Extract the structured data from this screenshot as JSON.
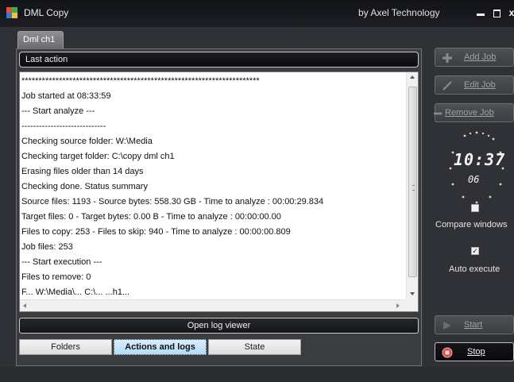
{
  "window": {
    "title": "DML Copy",
    "vendor": "by Axel Technology",
    "minimize_label": "",
    "maximize_label": "",
    "close_label": "x"
  },
  "tabs": [
    {
      "label": "Dml ch1"
    }
  ],
  "section": {
    "header": "Last action"
  },
  "log": {
    "lines": [
      "**********************************************************************",
      "Job started at 08:33:59",
      "--- Start analyze ---",
      "-----------------------------",
      "Checking source folder: W:\\Media",
      "Checking target folder: C:\\copy dml ch1",
      "Erasing files older than 14 days",
      "Checking done. Status summary",
      "Source files: 1193 - Source bytes: 558.30 GB - Time to analyze : 00:00:29.834",
      "Target files: 0 - Target bytes: 0.00 B - Time to analyze : 00:00:00.00",
      "Files to copy: 253 - Files to skip: 940 - Time to analyze : 00:00:00.809",
      "Job files: 253",
      "--- Start execution ---",
      "Files to remove: 0",
      "F...   W:\\Media\\...   C:\\...   ...h1..."
    ]
  },
  "buttons": {
    "open_log_viewer": "Open log viewer",
    "add_job": "Add Job",
    "edit_job": "Edit Job",
    "remove_job": "Remove Job",
    "start": "Start",
    "stop": "Stop"
  },
  "bottom_tabs": [
    {
      "label": "Folders"
    },
    {
      "label": "Actions and logs",
      "selected": true
    },
    {
      "label": "State"
    }
  ],
  "clock": {
    "time": "10:37",
    "seconds": "06"
  },
  "options": {
    "compare_windows": {
      "label": "Compare windows",
      "checked": false
    },
    "auto_execute": {
      "label": "Auto execute",
      "checked": true,
      "mark": "✓"
    }
  },
  "colors": {
    "background": "#2f3136",
    "title_bar": "#111318",
    "selected_tab": "#b5dcf5",
    "stop_icon": "#e04040"
  },
  "icons": {
    "app": "app-logo-icon",
    "add": "plus-icon",
    "edit": "pencil-icon",
    "remove": "minus-icon",
    "start": "play-icon",
    "stop": "stop-circle-icon"
  }
}
